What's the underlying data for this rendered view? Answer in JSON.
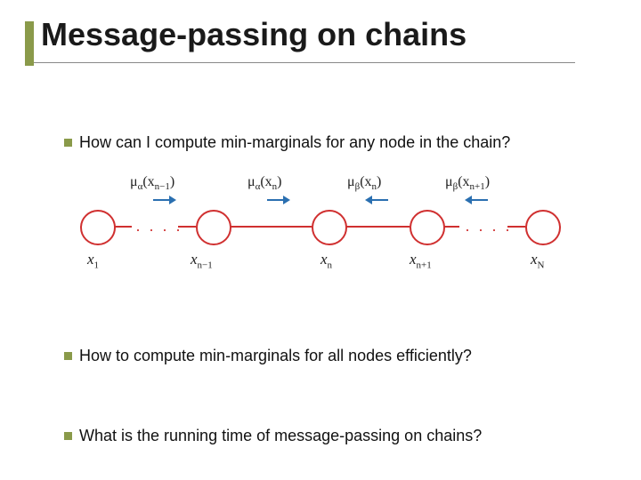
{
  "title": "Message-passing on chains",
  "bullets": {
    "q1": "How can I compute min-marginals for any node in the chain?",
    "q2": "How to compute min-marginals for all nodes efficiently?",
    "q3": "What is the running time of message-passing on chains?"
  },
  "diagram": {
    "node_labels": {
      "x1": "x",
      "x1_sub": "1",
      "x2": "x",
      "x2_sub": "n−1",
      "x3": "x",
      "x3_sub": "n",
      "x4": "x",
      "x4_sub": "n+1",
      "x5": "x",
      "x5_sub": "N"
    },
    "messages": {
      "m1": "μ",
      "m1_sub": "α",
      "m1_arg_x": "x",
      "m1_arg_sub": "n−1",
      "m2": "μ",
      "m2_sub": "α",
      "m2_arg_x": "x",
      "m2_arg_sub": "n",
      "m3": "μ",
      "m3_sub": "β",
      "m3_arg_x": "x",
      "m3_arg_sub": "n",
      "m4": "μ",
      "m4_sub": "β",
      "m4_arg_x": "x",
      "m4_arg_sub": "n+1"
    },
    "dots": "· · · ·"
  },
  "colors": {
    "accent": "#8a9a4a",
    "node": "#d03030",
    "arrow": "#2a6fb0"
  }
}
